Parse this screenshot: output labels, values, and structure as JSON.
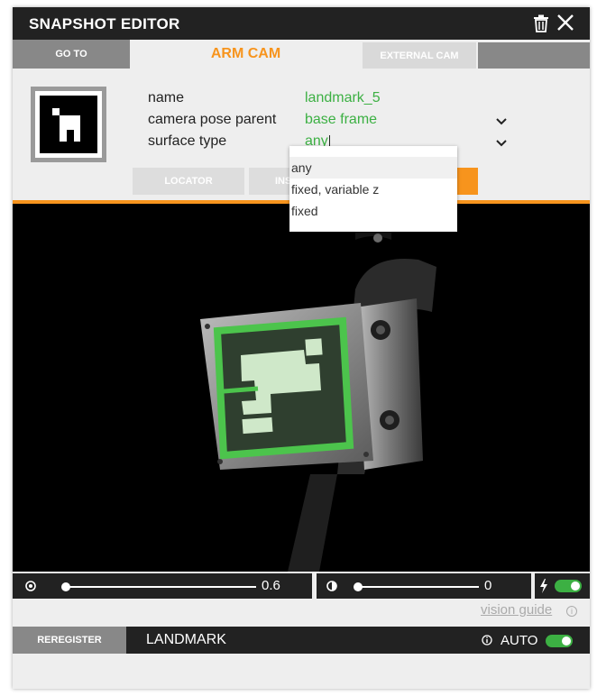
{
  "window": {
    "title": "SNAPSHOT EDITOR"
  },
  "tabs": {
    "goto": "GO TO",
    "arm_cam": "ARM CAM",
    "external_cam": "EXTERNAL CAM"
  },
  "fields": [
    {
      "label": "name",
      "value": "landmark_5"
    },
    {
      "label": "camera pose parent",
      "value": "base frame"
    },
    {
      "label": "surface type",
      "value": "any"
    }
  ],
  "buttons": {
    "locator": "LOCATOR",
    "second_partial": "INS"
  },
  "dropdown": {
    "options": [
      "any",
      "fixed, variable z",
      "fixed"
    ],
    "selected": "any"
  },
  "sliders": {
    "exposure_value": "0.6",
    "exposure_level": 1.0,
    "contrast_value": "0",
    "contrast_level": 1.0
  },
  "vision_guide": "vision guide",
  "bottom": {
    "reregister": "REREGISTER",
    "section": "LANDMARK",
    "auto": "AUTO"
  },
  "colors": {
    "accent": "#f7941d",
    "green": "#3cb043",
    "dark": "#222222"
  }
}
